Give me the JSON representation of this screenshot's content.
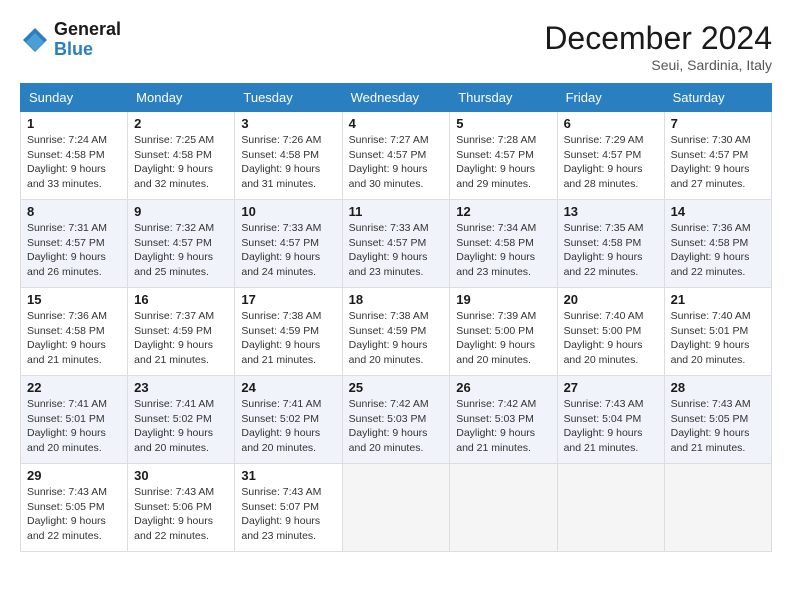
{
  "logo": {
    "line1": "General",
    "line2": "Blue"
  },
  "title": "December 2024",
  "location": "Seui, Sardinia, Italy",
  "days_of_week": [
    "Sunday",
    "Monday",
    "Tuesday",
    "Wednesday",
    "Thursday",
    "Friday",
    "Saturday"
  ],
  "weeks": [
    [
      {
        "day": 1,
        "sunrise": "7:24 AM",
        "sunset": "4:58 PM",
        "daylight": "9 hours and 33 minutes."
      },
      {
        "day": 2,
        "sunrise": "7:25 AM",
        "sunset": "4:58 PM",
        "daylight": "9 hours and 32 minutes."
      },
      {
        "day": 3,
        "sunrise": "7:26 AM",
        "sunset": "4:58 PM",
        "daylight": "9 hours and 31 minutes."
      },
      {
        "day": 4,
        "sunrise": "7:27 AM",
        "sunset": "4:57 PM",
        "daylight": "9 hours and 30 minutes."
      },
      {
        "day": 5,
        "sunrise": "7:28 AM",
        "sunset": "4:57 PM",
        "daylight": "9 hours and 29 minutes."
      },
      {
        "day": 6,
        "sunrise": "7:29 AM",
        "sunset": "4:57 PM",
        "daylight": "9 hours and 28 minutes."
      },
      {
        "day": 7,
        "sunrise": "7:30 AM",
        "sunset": "4:57 PM",
        "daylight": "9 hours and 27 minutes."
      }
    ],
    [
      {
        "day": 8,
        "sunrise": "7:31 AM",
        "sunset": "4:57 PM",
        "daylight": "9 hours and 26 minutes."
      },
      {
        "day": 9,
        "sunrise": "7:32 AM",
        "sunset": "4:57 PM",
        "daylight": "9 hours and 25 minutes."
      },
      {
        "day": 10,
        "sunrise": "7:33 AM",
        "sunset": "4:57 PM",
        "daylight": "9 hours and 24 minutes."
      },
      {
        "day": 11,
        "sunrise": "7:33 AM",
        "sunset": "4:57 PM",
        "daylight": "9 hours and 23 minutes."
      },
      {
        "day": 12,
        "sunrise": "7:34 AM",
        "sunset": "4:58 PM",
        "daylight": "9 hours and 23 minutes."
      },
      {
        "day": 13,
        "sunrise": "7:35 AM",
        "sunset": "4:58 PM",
        "daylight": "9 hours and 22 minutes."
      },
      {
        "day": 14,
        "sunrise": "7:36 AM",
        "sunset": "4:58 PM",
        "daylight": "9 hours and 22 minutes."
      }
    ],
    [
      {
        "day": 15,
        "sunrise": "7:36 AM",
        "sunset": "4:58 PM",
        "daylight": "9 hours and 21 minutes."
      },
      {
        "day": 16,
        "sunrise": "7:37 AM",
        "sunset": "4:59 PM",
        "daylight": "9 hours and 21 minutes."
      },
      {
        "day": 17,
        "sunrise": "7:38 AM",
        "sunset": "4:59 PM",
        "daylight": "9 hours and 21 minutes."
      },
      {
        "day": 18,
        "sunrise": "7:38 AM",
        "sunset": "4:59 PM",
        "daylight": "9 hours and 20 minutes."
      },
      {
        "day": 19,
        "sunrise": "7:39 AM",
        "sunset": "5:00 PM",
        "daylight": "9 hours and 20 minutes."
      },
      {
        "day": 20,
        "sunrise": "7:40 AM",
        "sunset": "5:00 PM",
        "daylight": "9 hours and 20 minutes."
      },
      {
        "day": 21,
        "sunrise": "7:40 AM",
        "sunset": "5:01 PM",
        "daylight": "9 hours and 20 minutes."
      }
    ],
    [
      {
        "day": 22,
        "sunrise": "7:41 AM",
        "sunset": "5:01 PM",
        "daylight": "9 hours and 20 minutes."
      },
      {
        "day": 23,
        "sunrise": "7:41 AM",
        "sunset": "5:02 PM",
        "daylight": "9 hours and 20 minutes."
      },
      {
        "day": 24,
        "sunrise": "7:41 AM",
        "sunset": "5:02 PM",
        "daylight": "9 hours and 20 minutes."
      },
      {
        "day": 25,
        "sunrise": "7:42 AM",
        "sunset": "5:03 PM",
        "daylight": "9 hours and 20 minutes."
      },
      {
        "day": 26,
        "sunrise": "7:42 AM",
        "sunset": "5:03 PM",
        "daylight": "9 hours and 21 minutes."
      },
      {
        "day": 27,
        "sunrise": "7:43 AM",
        "sunset": "5:04 PM",
        "daylight": "9 hours and 21 minutes."
      },
      {
        "day": 28,
        "sunrise": "7:43 AM",
        "sunset": "5:05 PM",
        "daylight": "9 hours and 21 minutes."
      }
    ],
    [
      {
        "day": 29,
        "sunrise": "7:43 AM",
        "sunset": "5:05 PM",
        "daylight": "9 hours and 22 minutes."
      },
      {
        "day": 30,
        "sunrise": "7:43 AM",
        "sunset": "5:06 PM",
        "daylight": "9 hours and 22 minutes."
      },
      {
        "day": 31,
        "sunrise": "7:43 AM",
        "sunset": "5:07 PM",
        "daylight": "9 hours and 23 minutes."
      },
      null,
      null,
      null,
      null
    ]
  ]
}
